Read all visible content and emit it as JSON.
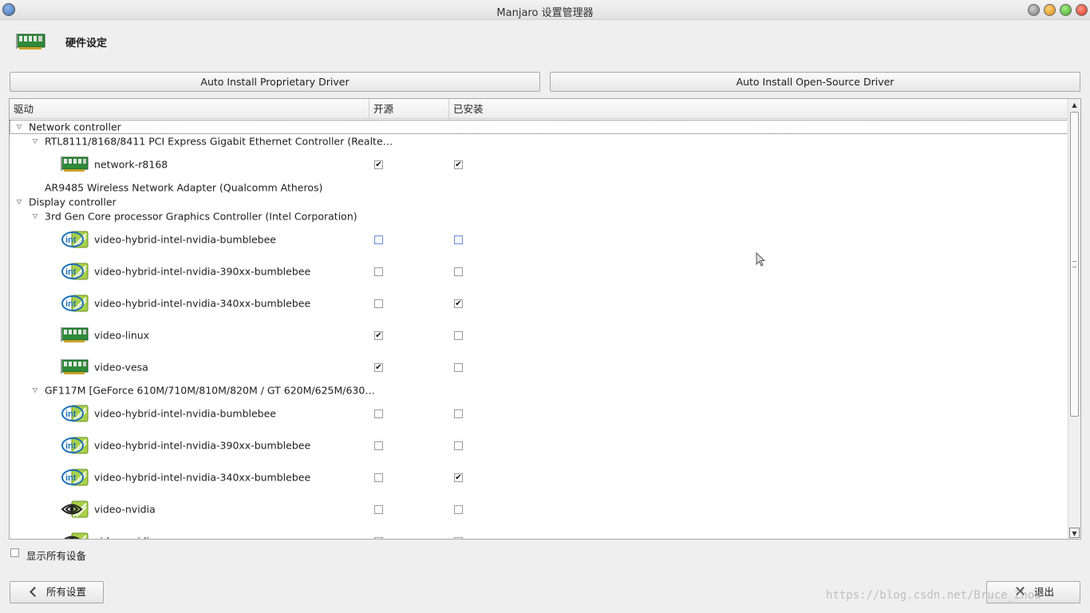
{
  "window": {
    "title": "Manjaro 设置管理器"
  },
  "header": {
    "title": "硬件设定",
    "icon": "network-card-icon"
  },
  "buttons": {
    "auto_proprietary": "Auto Install Proprietary Driver",
    "auto_open_source": "Auto Install Open-Source Driver",
    "back": "所有设置",
    "quit": "退出"
  },
  "tree": {
    "columns": [
      "驱动",
      "开源",
      "已安装"
    ],
    "rows": [
      {
        "type": "group",
        "label": "Network controller",
        "expanded": true
      },
      {
        "type": "device",
        "label": "RTL8111/8168/8411 PCI Express Gigabit Ethernet Controller (Realte…",
        "expanded": true
      },
      {
        "type": "driver",
        "label": "network-r8168",
        "icon": "network-card-icon",
        "open": true,
        "installed": true
      },
      {
        "type": "device-noexp",
        "label": "AR9485 Wireless Network Adapter (Qualcomm Atheros)"
      },
      {
        "type": "group",
        "label": "Display controller",
        "expanded": true
      },
      {
        "type": "device",
        "label": "3rd Gen Core processor Graphics Controller (Intel Corporation)",
        "expanded": true
      },
      {
        "type": "driver",
        "label": "video-hybrid-intel-nvidia-bumblebee",
        "icon": "intel-icon",
        "open": false,
        "installed": false,
        "focus": true
      },
      {
        "type": "driver",
        "label": "video-hybrid-intel-nvidia-390xx-bumblebee",
        "icon": "intel-icon",
        "open": false,
        "installed": false
      },
      {
        "type": "driver",
        "label": "video-hybrid-intel-nvidia-340xx-bumblebee",
        "icon": "intel-icon",
        "open": false,
        "installed": true
      },
      {
        "type": "driver",
        "label": "video-linux",
        "icon": "network-card-icon",
        "open": true,
        "installed": false
      },
      {
        "type": "driver",
        "label": "video-vesa",
        "icon": "network-card-icon",
        "open": true,
        "installed": false
      },
      {
        "type": "device",
        "label": "GF117M [GeForce 610M/710M/810M/820M / GT 620M/625M/630…",
        "expanded": true
      },
      {
        "type": "driver",
        "label": "video-hybrid-intel-nvidia-bumblebee",
        "icon": "intel-icon",
        "open": false,
        "installed": false
      },
      {
        "type": "driver",
        "label": "video-hybrid-intel-nvidia-390xx-bumblebee",
        "icon": "intel-icon",
        "open": false,
        "installed": false
      },
      {
        "type": "driver",
        "label": "video-hybrid-intel-nvidia-340xx-bumblebee",
        "icon": "intel-icon",
        "open": false,
        "installed": true
      },
      {
        "type": "driver",
        "label": "video-nvidia",
        "icon": "nvidia-icon",
        "open": false,
        "installed": false
      },
      {
        "type": "driver",
        "label": "video-nvidia",
        "icon": "nvidia-icon",
        "open": false,
        "installed": false
      }
    ]
  },
  "show_all_devices": {
    "label": "显示所有设备",
    "checked": false
  },
  "watermark": "https://blog.csdn.net/Bruce_Zhou"
}
